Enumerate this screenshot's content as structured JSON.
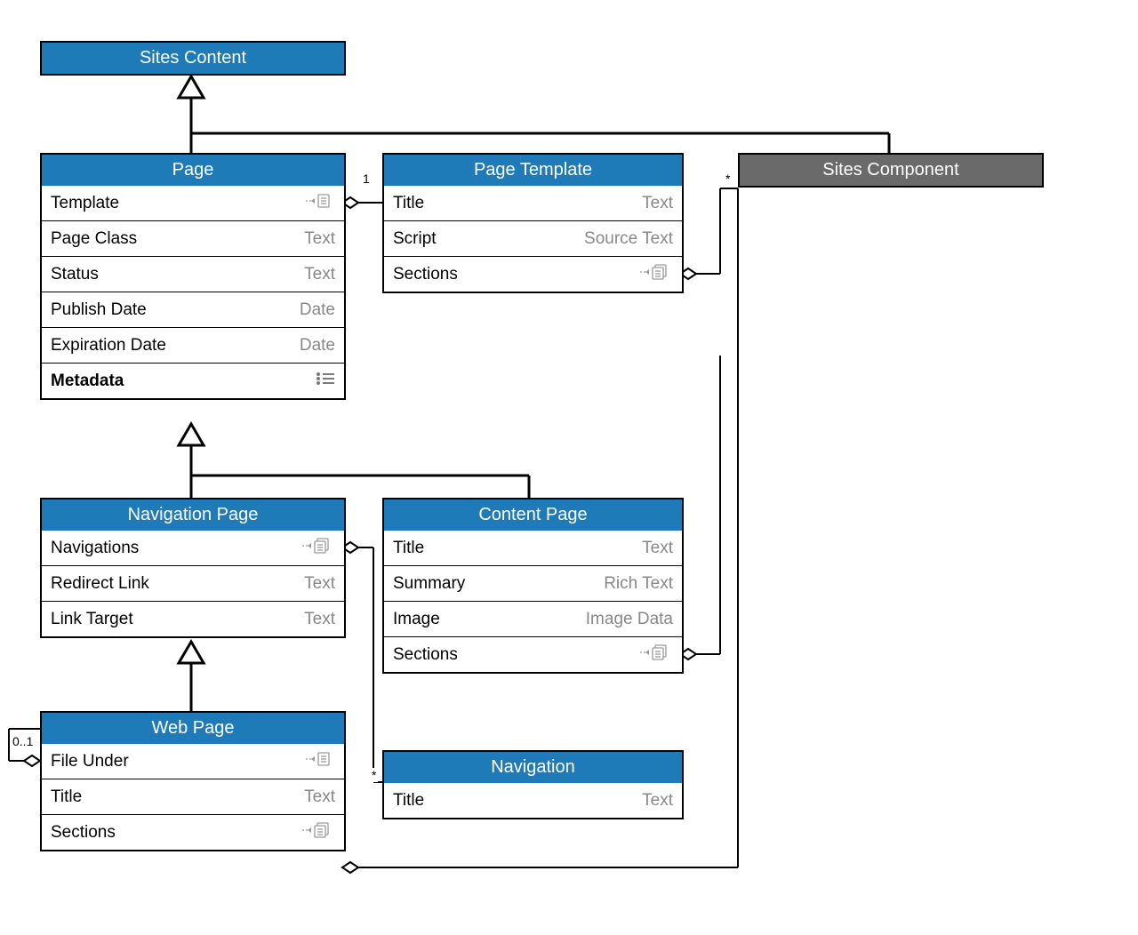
{
  "sitesContent": {
    "title": "Sites Content"
  },
  "sitesComponent": {
    "title": "Sites Component"
  },
  "page": {
    "title": "Page",
    "attrs": [
      {
        "name": "Template",
        "type": "ref1"
      },
      {
        "name": "Page Class",
        "type": "Text"
      },
      {
        "name": "Status",
        "type": "Text"
      },
      {
        "name": "Publish Date",
        "type": "Date"
      },
      {
        "name": "Expiration Date",
        "type": "Date"
      },
      {
        "name": "Metadata",
        "type": "dict",
        "bold": true
      }
    ]
  },
  "pageTemplate": {
    "title": "Page Template",
    "attrs": [
      {
        "name": "Title",
        "type": "Text"
      },
      {
        "name": "Script",
        "type": "Source Text"
      },
      {
        "name": "Sections",
        "type": "refN"
      }
    ]
  },
  "navPage": {
    "title": "Navigation Page",
    "attrs": [
      {
        "name": "Navigations",
        "type": "refN"
      },
      {
        "name": "Redirect Link",
        "type": "Text"
      },
      {
        "name": "Link Target",
        "type": "Text"
      }
    ]
  },
  "contentPage": {
    "title": "Content Page",
    "attrs": [
      {
        "name": "Title",
        "type": "Text"
      },
      {
        "name": "Summary",
        "type": "Rich Text"
      },
      {
        "name": "Image",
        "type": "Image Data"
      },
      {
        "name": "Sections",
        "type": "refN"
      }
    ]
  },
  "webPage": {
    "title": "Web Page",
    "attrs": [
      {
        "name": "File Under",
        "type": "ref1"
      },
      {
        "name": "Title",
        "type": "Text"
      },
      {
        "name": "Sections",
        "type": "refN"
      }
    ]
  },
  "navigation": {
    "title": "Navigation",
    "attrs": [
      {
        "name": "Title",
        "type": "Text"
      }
    ]
  },
  "mult": {
    "one": "1",
    "star": "*",
    "zeroOne": "0..1"
  }
}
